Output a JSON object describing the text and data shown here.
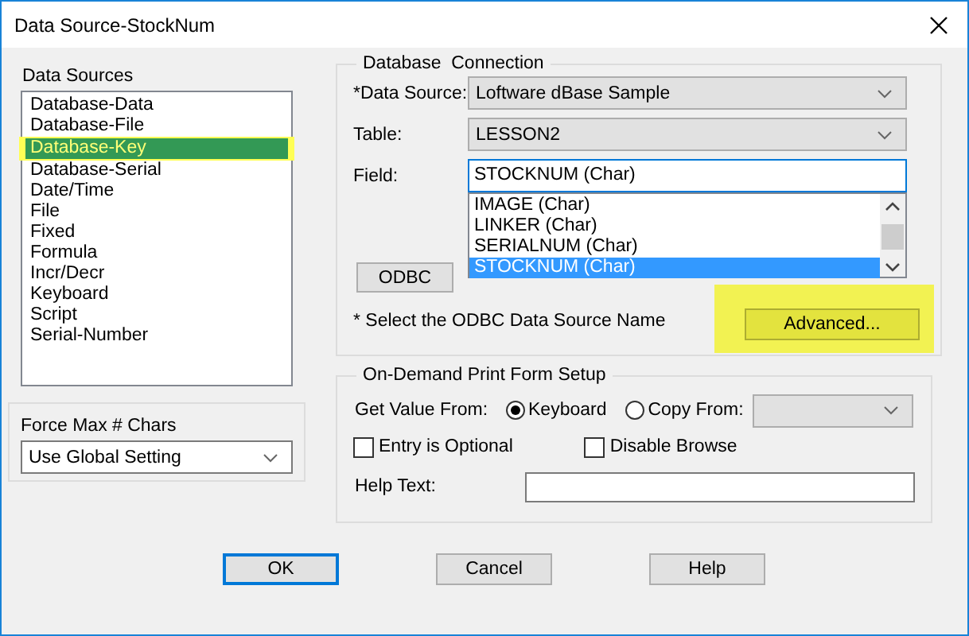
{
  "window": {
    "title": "Data Source-StockNum"
  },
  "data_sources": {
    "label": "Data Sources",
    "items": [
      {
        "label": "Database-Data",
        "selected": false,
        "highlighted": false
      },
      {
        "label": "Database-File",
        "selected": false,
        "highlighted": false
      },
      {
        "label": "Database-Key",
        "selected": true,
        "highlighted": true
      },
      {
        "label": "Database-Serial",
        "selected": false,
        "highlighted": false
      },
      {
        "label": "Date/Time",
        "selected": false,
        "highlighted": false
      },
      {
        "label": "File",
        "selected": false,
        "highlighted": false
      },
      {
        "label": "Fixed",
        "selected": false,
        "highlighted": false
      },
      {
        "label": "Formula",
        "selected": false,
        "highlighted": false
      },
      {
        "label": "Incr/Decr",
        "selected": false,
        "highlighted": false
      },
      {
        "label": "Keyboard",
        "selected": false,
        "highlighted": false
      },
      {
        "label": "Script",
        "selected": false,
        "highlighted": false
      },
      {
        "label": "Serial-Number",
        "selected": false,
        "highlighted": false
      }
    ]
  },
  "force_max": {
    "label": "Force Max # Chars",
    "value": "Use Global Setting"
  },
  "database_connection": {
    "title": "Database  Connection",
    "data_source": {
      "label": "*Data Source:",
      "value": "Loftware dBase Sample"
    },
    "table": {
      "label": "Table:",
      "value": "LESSON2"
    },
    "field": {
      "label": "Field:",
      "value": "STOCKNUM (Char)",
      "options": [
        {
          "label": "IMAGE (Char)",
          "selected": false
        },
        {
          "label": "LINKER (Char)",
          "selected": false
        },
        {
          "label": "SERIALNUM (Char)",
          "selected": false
        },
        {
          "label": "STOCKNUM (Char)",
          "selected": true
        }
      ]
    },
    "odbc_button": "ODBC",
    "note": "* Select the ODBC Data Source Name",
    "advanced_button": {
      "label": "Advanced...",
      "highlighted": true
    }
  },
  "on_demand": {
    "title": "On-Demand Print Form Setup",
    "get_value_label": "Get Value From:",
    "sources": [
      {
        "label": "Keyboard",
        "selected": true
      },
      {
        "label": "Copy From:",
        "selected": false
      }
    ],
    "checkboxes": [
      {
        "label": "Entry is Optional",
        "checked": false
      },
      {
        "label": "Disable Browse",
        "checked": false
      }
    ],
    "help_text_label": "Help Text:"
  },
  "buttons": [
    {
      "label": "OK",
      "focused": true
    },
    {
      "label": "Cancel",
      "focused": false
    },
    {
      "label": "Help",
      "focused": false
    }
  ]
}
